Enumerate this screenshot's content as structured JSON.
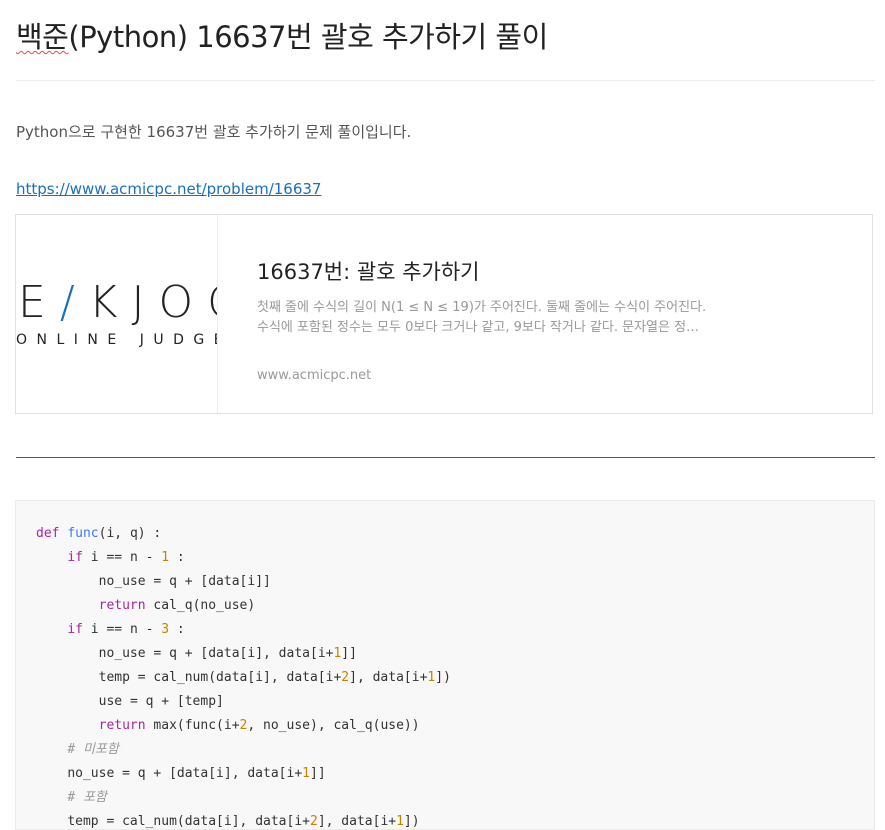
{
  "post": {
    "title_prefix": "백준",
    "title_rest": "(Python) 16637번 괄호 추가하기 풀이",
    "intro": "Python으로 구현한 16637번 괄호 추가하기 문제 풀이입니다.",
    "link": "https://www.acmicpc.net/problem/16637"
  },
  "card": {
    "logo_e": "E",
    "logo_slash": "/",
    "logo_rest": "KJOC",
    "logo_small": "ONLINE JUDGE",
    "title": "16637번: 괄호 추가하기",
    "desc_line1": "첫째 줄에 수식의 길이 N(1 ≤ N ≤ 19)가 주어진다. 둘째 줄에는 수식이 주어진다.",
    "desc_line2": "수식에 포함된 정수는 모두 0보다 크거나 같고, 9보다 작거나 같다. 문자열은 정…",
    "host": "www.acmicpc.net"
  },
  "code": {
    "lines": [
      "def func(i, q) :",
      "    if i == n - 1 :",
      "        no_use = q + [data[i]]",
      "        return cal_q(no_use)",
      "    if i == n - 3 :",
      "        no_use = q + [data[i], data[i+1]]",
      "        temp = cal_num(data[i], data[i+2], data[i+1])",
      "        use = q + [temp]",
      "        return max(func(i+2, no_use), cal_q(use))",
      "    # 미포함",
      "    no_use = q + [data[i], data[i+1]]",
      "    # 포함",
      "    temp = cal_num(data[i], data[i+2], data[i+1])"
    ]
  }
}
